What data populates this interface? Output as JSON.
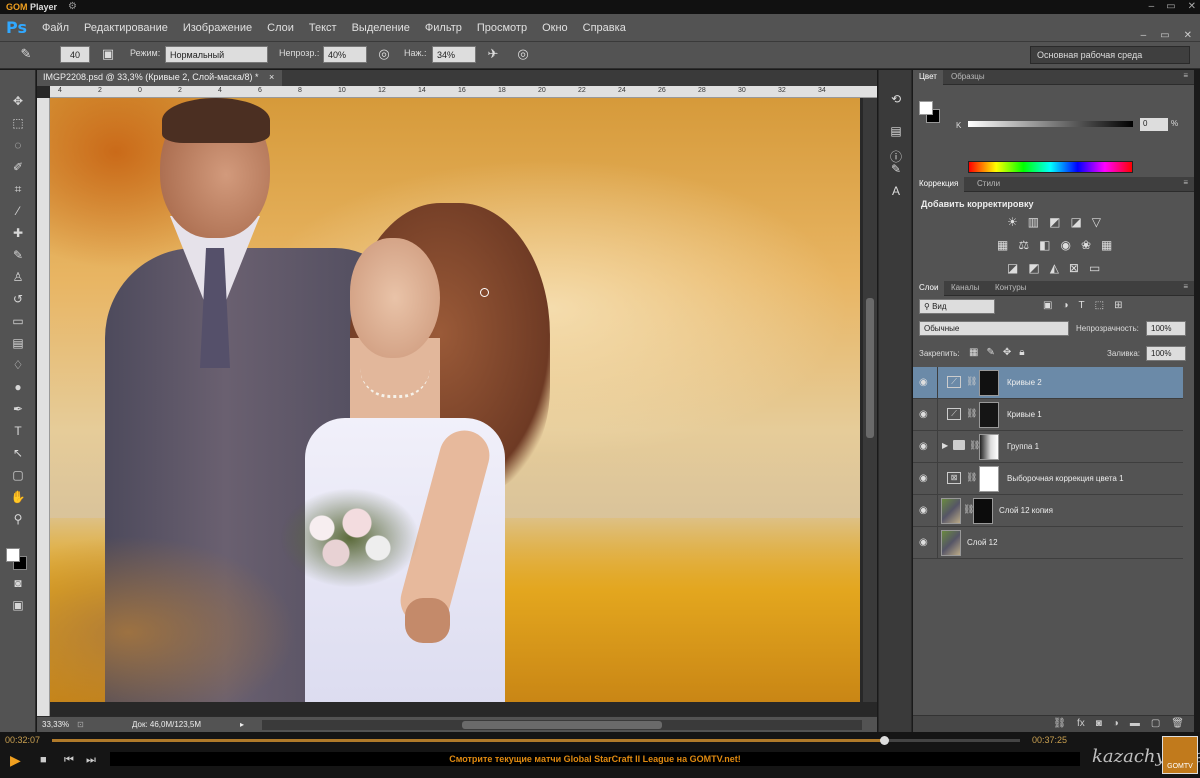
{
  "player": {
    "logo_brand": "GOM",
    "logo_suffix": "Player",
    "time_elapsed": "00:32:07",
    "time_total": "00:37:25",
    "ticker": "Смотрите текущие матчи Global StarCraft II League на GOMTV.net!",
    "watermark": "kazachya.net",
    "badge": "GOMTV",
    "progress": 0.86
  },
  "photoshop": {
    "logo": "Ps",
    "menu": [
      "Файл",
      "Редактирование",
      "Изображение",
      "Слои",
      "Текст",
      "Выделение",
      "Фильтр",
      "Просмотр",
      "Окно",
      "Справка"
    ],
    "options": {
      "brush_size": "40",
      "mode_label": "Режим:",
      "mode_value": "Нормальный",
      "opacity_label": "Непрозр.:",
      "opacity_value": "40%",
      "flow_label": "Наж.:",
      "flow_value": "34%",
      "workspace": "Основная рабочая среда"
    },
    "document": {
      "tab_title": "IMGP2208.psd @ 33,3% (Кривые 2, Слой-маска/8) *",
      "close_label": "×",
      "ruler_numbers": [
        "4",
        "2",
        "0",
        "2",
        "4",
        "6",
        "8",
        "10",
        "12",
        "14",
        "16",
        "18",
        "20",
        "22",
        "24",
        "26",
        "28",
        "30",
        "32",
        "34"
      ],
      "zoom": "33,33%",
      "doc_info": "Док: 46,0M/123,5M"
    },
    "color_panel": {
      "tabs": [
        "Цвет",
        "Образцы"
      ],
      "channel_label": "K",
      "value": "0",
      "unit": "%"
    },
    "adjustments_panel": {
      "tabs": [
        "Коррекция",
        "Стили"
      ],
      "title": "Добавить корректировку"
    },
    "layers_panel": {
      "tabs": [
        "Слои",
        "Каналы",
        "Контуры"
      ],
      "filter": "Вид",
      "blend_mode": "Обычные",
      "opacity_label": "Непрозрачность:",
      "opacity_value": "100%",
      "lock_label": "Закрепить:",
      "fill_label": "Заливка:",
      "fill_value": "100%",
      "layers": [
        {
          "name": "Кривые 2"
        },
        {
          "name": "Кривые 1"
        },
        {
          "name": "Группа 1"
        },
        {
          "name": "Выборочная коррекция цвета 1"
        },
        {
          "name": "Слой 12 копия"
        },
        {
          "name": "Слой 12"
        }
      ]
    }
  },
  "colors": {
    "ps_blue": "#31a8ff",
    "gom_orange": "#f0a020",
    "selected_layer": "#6b8aa8",
    "panel_bg": "#535353"
  }
}
